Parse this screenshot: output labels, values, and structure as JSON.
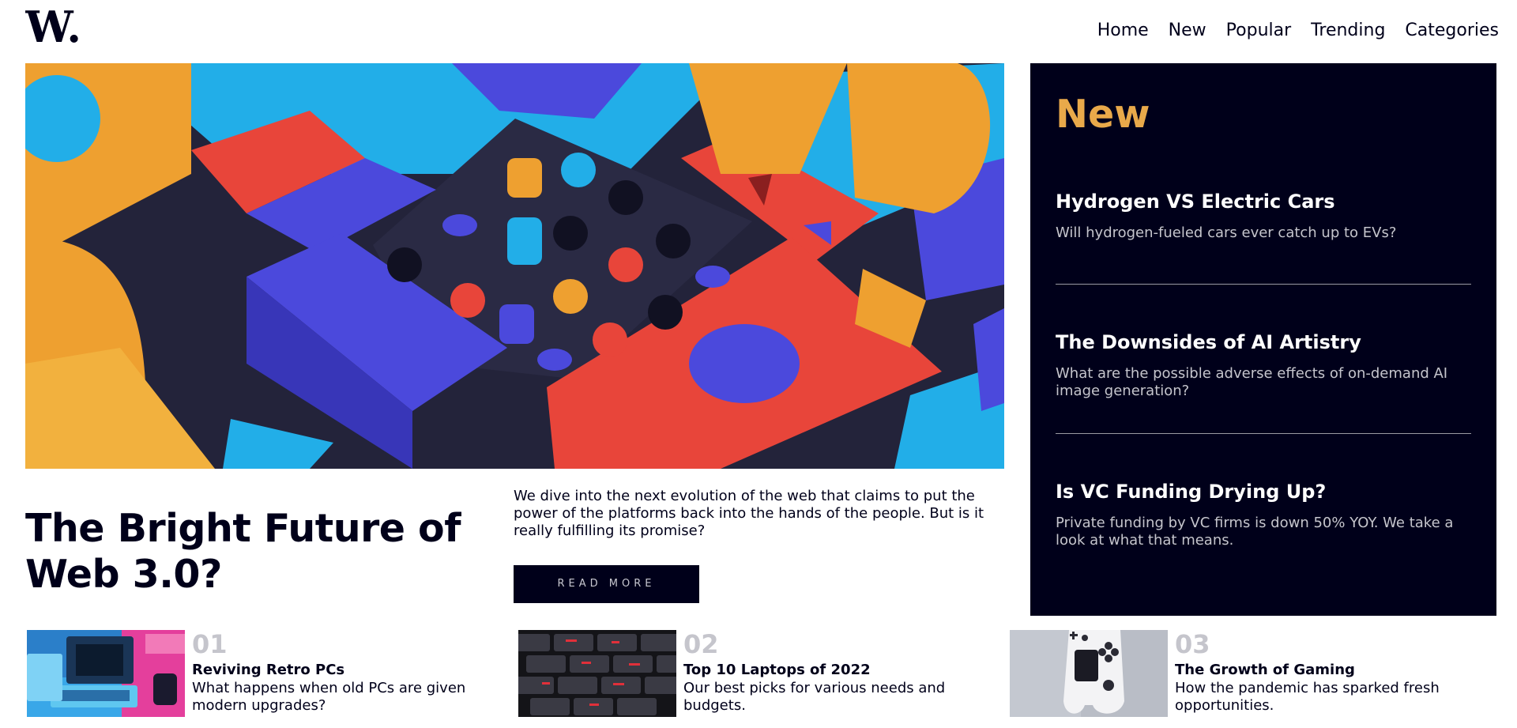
{
  "brand": {
    "logo_text": "W."
  },
  "nav": {
    "items": [
      "Home",
      "New",
      "Popular",
      "Trending",
      "Categories"
    ]
  },
  "hero": {
    "image_name": "abstract-3d-blocks-image",
    "headline": "The Bright Future of Web 3.0?",
    "excerpt": "We dive into the next evolution of the web that claims to put the power of the platforms back into the hands of the people. But is it really fulfilling its promise?",
    "read_more": "READ MORE"
  },
  "new_panel": {
    "heading": "New",
    "items": [
      {
        "title": "Hydrogen VS Electric Cars",
        "summary": "Will hydrogen-fueled cars ever catch up to EVs?"
      },
      {
        "title": "The Downsides of AI Artistry",
        "summary": "What are the possible adverse effects of on-demand AI image generation?"
      },
      {
        "title": "Is VC Funding Drying Up?",
        "summary": "Private funding by VC firms is down 50% YOY. We take a look at what that means."
      }
    ]
  },
  "cards": [
    {
      "number": "01",
      "title": "Reviving Retro PCs",
      "description": "What happens when old PCs are given modern upgrades?",
      "image_name": "retro-pc-image"
    },
    {
      "number": "02",
      "title": "Top 10 Laptops of 2022",
      "description": "Our best picks for various needs and budgets.",
      "image_name": "keyboard-image"
    },
    {
      "number": "03",
      "title": "The Growth of Gaming",
      "description": "How the pandemic has sparked fresh opportunities.",
      "image_name": "gamepad-image"
    }
  ],
  "colors": {
    "navy": "#00001a",
    "accent_orange": "#e9a94a",
    "muted_gray": "#c5c5cc",
    "hero_red": "#e8453a",
    "hero_blue": "#4b49dc",
    "hero_cyan": "#22aee8",
    "hero_orange": "#eea030"
  }
}
